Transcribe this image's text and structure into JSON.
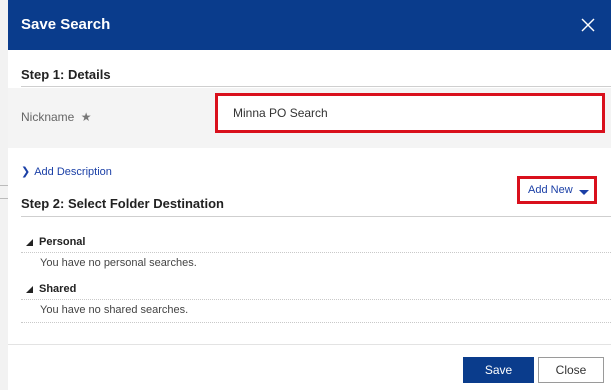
{
  "dialog": {
    "title": "Save Search",
    "close_icon": "close-icon"
  },
  "step1": {
    "title": "Step 1: Details",
    "nickname_label": "Nickname",
    "required_icon": "star-icon",
    "nickname_value": "Minna PO Search",
    "add_description": "Add Description"
  },
  "step2": {
    "title": "Step 2: Select Folder Destination",
    "add_new": "Add New",
    "folders": [
      {
        "label": "Personal",
        "empty_text": "You have no personal searches."
      },
      {
        "label": "Shared",
        "empty_text": "You have no shared searches."
      }
    ]
  },
  "footer": {
    "save_label": "Save",
    "close_label": "Close"
  },
  "colors": {
    "header_bg": "#0a3c8c",
    "link": "#1a3fa6",
    "highlight": "#d9101c"
  }
}
